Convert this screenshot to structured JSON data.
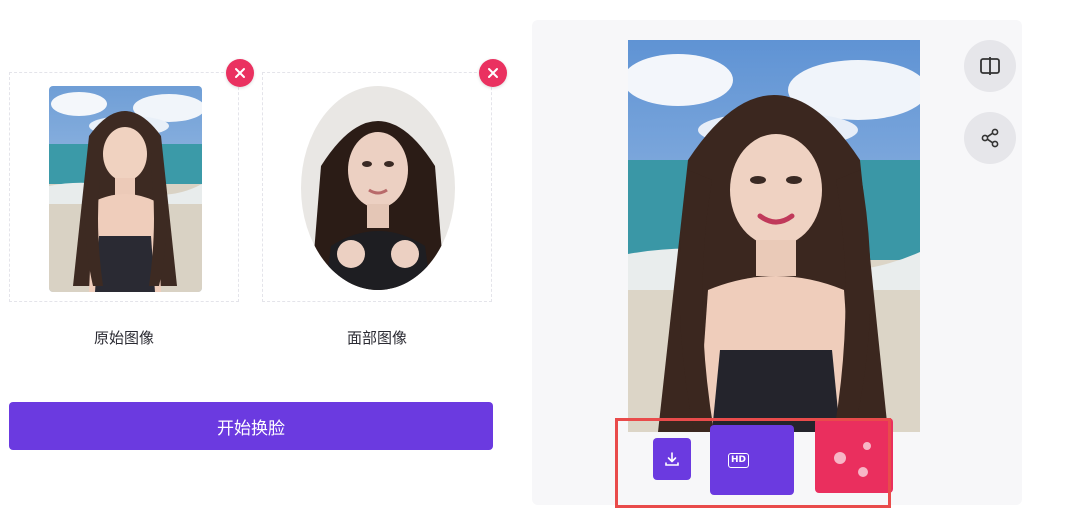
{
  "upload": {
    "original_caption": "原始图像",
    "face_caption": "面部图像",
    "remove_icon": "close-icon"
  },
  "actions": {
    "start_label": "开始换脸"
  },
  "result": {
    "hd_label": "HD",
    "compare_icon": "compare-icon",
    "share_icon": "share-icon",
    "download_icon": "download-icon",
    "random_icon": "dice-icon"
  },
  "colors": {
    "primary": "#6b3ae0",
    "danger": "#ea3160",
    "highlight": "#e94b4b",
    "panel_bg": "#f7f7f9"
  }
}
